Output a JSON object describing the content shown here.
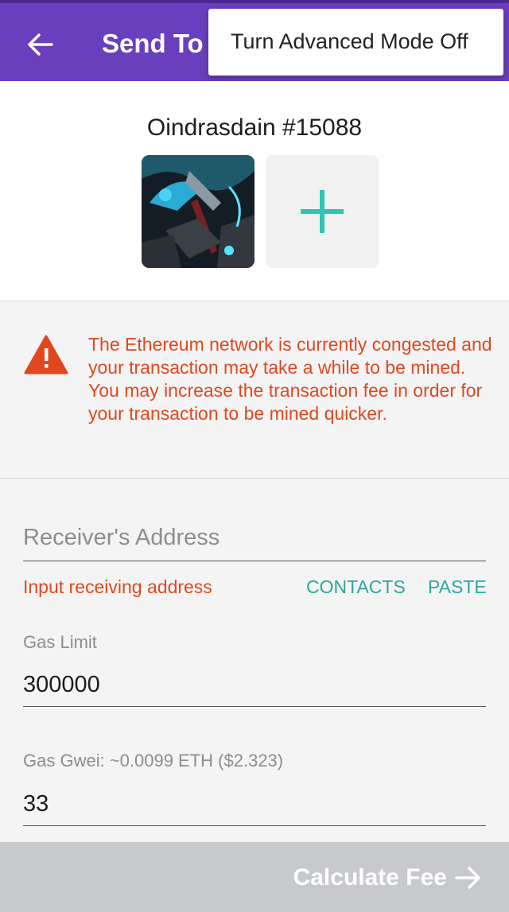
{
  "header": {
    "title": "Send To",
    "back_icon": "arrow-left-icon",
    "color": "#6a3fbd"
  },
  "menu": {
    "item": "Turn Advanced Mode Off"
  },
  "nft": {
    "name": "Oindrasdain #15088",
    "add_icon": "plus-icon",
    "accent": "#2ec4b6"
  },
  "warning": {
    "icon": "warning-triangle-icon",
    "color": "#e2471f",
    "message": "The Ethereum network is currently congested and your transaction may take a while to be mined. You may increase the transaction fee in order for your transaction to be mined quicker."
  },
  "form": {
    "receiver_placeholder": "Receiver's Address",
    "receiver_error": "Input receiving address",
    "contacts_label": "CONTACTS",
    "paste_label": "PASTE",
    "gas_limit_label": "Gas Limit",
    "gas_limit_value": "300000",
    "gas_gwei_label": "Gas Gwei: ~0.0099 ETH ($2.323)",
    "gas_gwei_value": "33"
  },
  "cta": {
    "label": "Calculate Fee",
    "icon": "arrow-right-icon"
  }
}
